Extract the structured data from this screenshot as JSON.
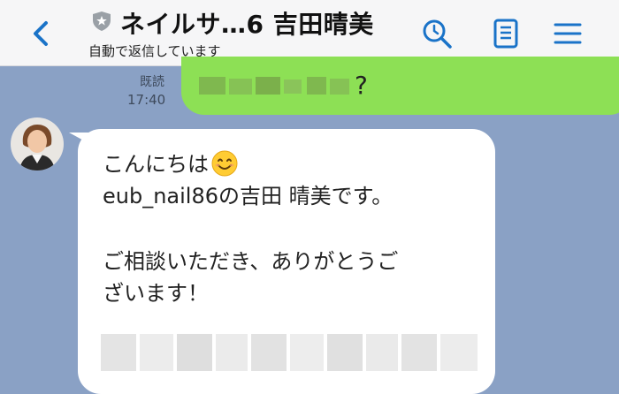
{
  "header": {
    "title": "ネイルサ…6 吉田晴美",
    "subtitle": "自動で返信しています",
    "icons": [
      "chevron-left-icon",
      "official-account-icon",
      "search-icon",
      "notes-icon",
      "menu-icon"
    ],
    "accent_color": "#1a73c8"
  },
  "sent_message": {
    "text_visible": "?",
    "read_status": "既読",
    "time": "17:40",
    "bubble_color": "#8de055"
  },
  "received_message": {
    "lines": [
      "こんにちは",
      "eub_nail86の吉田 晴美です。",
      "",
      "ご相談いただき、ありがとうご",
      "ざいます！"
    ],
    "emoji": "smiling-face-icon",
    "bubble_color": "#ffffff"
  },
  "background_color": "#8aa1c5"
}
